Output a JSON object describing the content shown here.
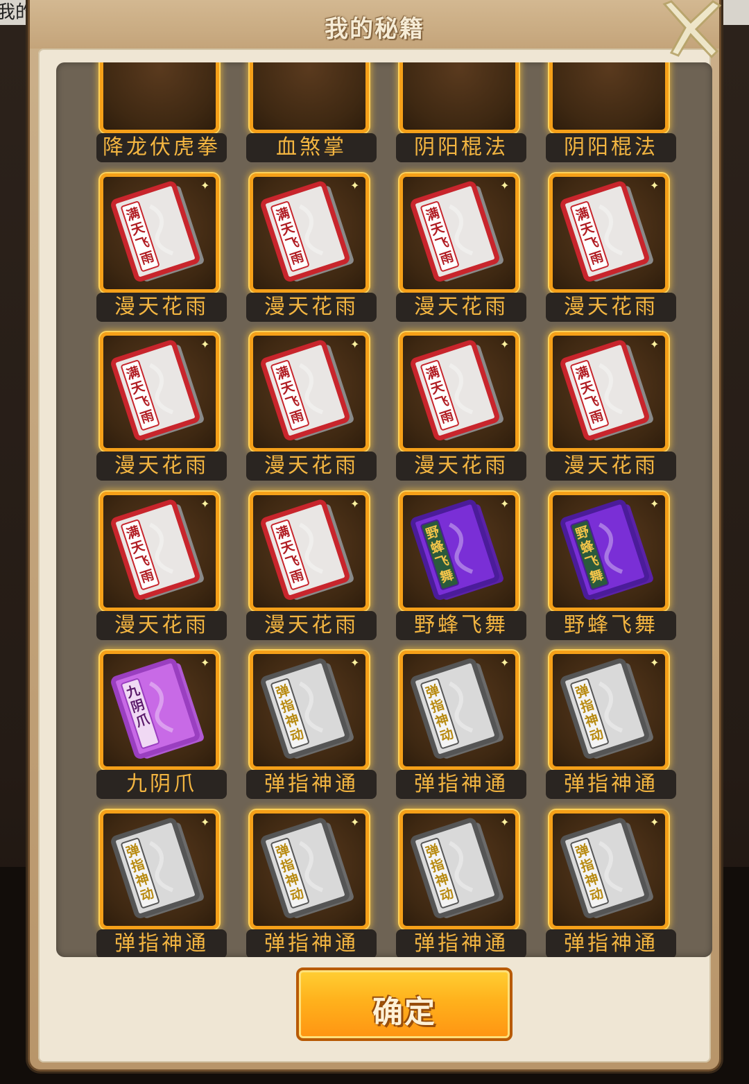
{
  "background": {
    "edge_text": "我的秘籍！"
  },
  "dialog": {
    "title": "我的秘籍",
    "close_icon": "close-x-icon",
    "confirm_label": "确定"
  },
  "items": [
    {
      "name": "降龙伏虎拳",
      "book": "partial"
    },
    {
      "name": "血煞掌",
      "book": "partial"
    },
    {
      "name": "阴阳棍法",
      "book": "partial"
    },
    {
      "name": "阴阳棍法",
      "book": "partial"
    },
    {
      "name": "漫天花雨",
      "book": "red",
      "cover_text": "满天飞雨"
    },
    {
      "name": "漫天花雨",
      "book": "red",
      "cover_text": "满天飞雨"
    },
    {
      "name": "漫天花雨",
      "book": "red",
      "cover_text": "满天飞雨"
    },
    {
      "name": "漫天花雨",
      "book": "red",
      "cover_text": "满天飞雨"
    },
    {
      "name": "漫天花雨",
      "book": "red",
      "cover_text": "满天飞雨"
    },
    {
      "name": "漫天花雨",
      "book": "red",
      "cover_text": "满天飞雨"
    },
    {
      "name": "漫天花雨",
      "book": "red",
      "cover_text": "满天飞雨"
    },
    {
      "name": "漫天花雨",
      "book": "red",
      "cover_text": "满天飞雨"
    },
    {
      "name": "漫天花雨",
      "book": "red",
      "cover_text": "满天飞雨"
    },
    {
      "name": "漫天花雨",
      "book": "red",
      "cover_text": "满天飞雨"
    },
    {
      "name": "野蜂飞舞",
      "book": "purple",
      "cover_text": "野蜂飞舞"
    },
    {
      "name": "野蜂飞舞",
      "book": "purple",
      "cover_text": "野蜂飞舞"
    },
    {
      "name": "九阴爪",
      "book": "violet",
      "cover_text": "九阴爪"
    },
    {
      "name": "弹指神通",
      "book": "gray",
      "cover_text": "弹指神动"
    },
    {
      "name": "弹指神通",
      "book": "gray",
      "cover_text": "弹指神动"
    },
    {
      "name": "弹指神通",
      "book": "gray",
      "cover_text": "弹指神动"
    },
    {
      "name": "弹指神通",
      "book": "gray",
      "cover_text": "弹指神动"
    },
    {
      "name": "弹指神通",
      "book": "gray",
      "cover_text": "弹指神动"
    },
    {
      "name": "弹指神通",
      "book": "gray",
      "cover_text": "弹指神动"
    },
    {
      "name": "弹指神通",
      "book": "gray",
      "cover_text": "弹指神动"
    }
  ],
  "colors": {
    "frame_orange": "#f5a019",
    "label_text": "#f3b541",
    "label_bg": "#2a2521",
    "panel_bg": "#6e6354",
    "button_orange": "#ffb11c"
  }
}
